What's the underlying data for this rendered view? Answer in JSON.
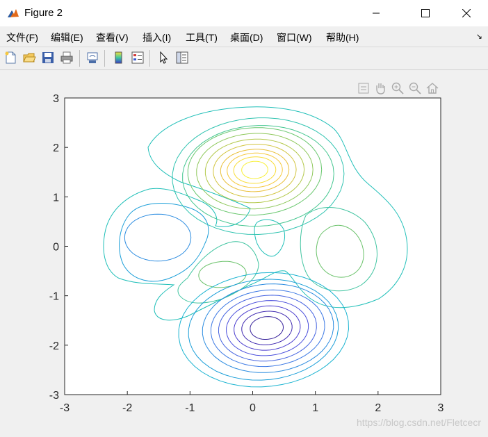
{
  "window": {
    "title": "Figure 2",
    "controls": [
      "minimize",
      "maximize",
      "close"
    ]
  },
  "menu": {
    "items": [
      "文件(F)",
      "编辑(E)",
      "查看(V)",
      "插入(I)",
      "工具(T)",
      "桌面(D)",
      "窗口(W)",
      "帮助(H)"
    ],
    "overflow_icon": "dock-arrow-icon"
  },
  "toolbar": {
    "buttons": [
      "new-figure-icon",
      "open-file-icon",
      "save-icon",
      "print-icon",
      "link-plot-icon",
      "colorbar-icon",
      "legend-icon",
      "pointer-icon",
      "property-editor-icon"
    ]
  },
  "axes_toolbar": {
    "buttons": [
      "data-tip-icon",
      "pan-hand-icon",
      "zoom-in-icon",
      "zoom-out-icon",
      "home-icon"
    ]
  },
  "chart_data": {
    "type": "contour",
    "title": "",
    "xlabel": "",
    "ylabel": "",
    "xlim": [
      -3,
      3
    ],
    "ylim": [
      -3,
      3
    ],
    "xticks": [
      "-3",
      "-2",
      "-1",
      "0",
      "1",
      "2",
      "3"
    ],
    "yticks": [
      "3",
      "2",
      "1",
      "0",
      "-1",
      "-2",
      "-3"
    ],
    "colormap": "parula",
    "features": [
      {
        "name": "peak",
        "center": [
          0,
          1.58
        ],
        "levels": 9
      },
      {
        "name": "valley",
        "center": [
          0.25,
          -1.65
        ],
        "levels": 8
      },
      {
        "name": "left-valley",
        "center": [
          -1.4,
          0.15
        ],
        "levels": 2
      },
      {
        "name": "right-peak",
        "center": [
          1.3,
          0.0
        ],
        "levels": 2
      },
      {
        "name": "lower-left-peak",
        "center": [
          -0.4,
          -0.55
        ],
        "levels": 2
      }
    ]
  },
  "watermark": "https://blog.csdn.net/Fletcecr"
}
